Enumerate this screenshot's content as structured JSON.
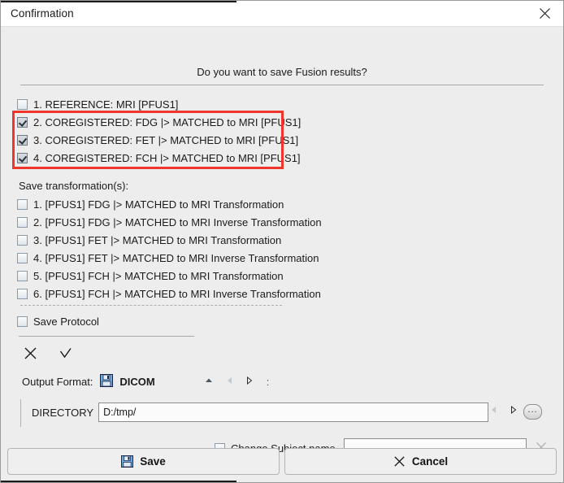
{
  "window": {
    "title": "Confirmation",
    "close_icon": "close-icon"
  },
  "question": "Do you want to save Fusion results?",
  "series": {
    "items": [
      {
        "label": "1. REFERENCE: MRI [PFUS1]",
        "checked": false
      },
      {
        "label": "2. COREGISTERED: FDG |> MATCHED to MRI [PFUS1]",
        "checked": true
      },
      {
        "label": "3. COREGISTERED: FET |> MATCHED to MRI [PFUS1]",
        "checked": true
      },
      {
        "label": "4. COREGISTERED: FCH |> MATCHED to MRI [PFUS1]",
        "checked": true
      }
    ],
    "highlight_color": "#f0352c"
  },
  "transformations": {
    "section_label": "Save transformation(s):",
    "items": [
      {
        "label": "1. [PFUS1] FDG |> MATCHED to MRI Transformation",
        "checked": false
      },
      {
        "label": "2. [PFUS1] FDG |> MATCHED to MRI Inverse Transformation",
        "checked": false
      },
      {
        "label": "3. [PFUS1] FET |> MATCHED to MRI Transformation",
        "checked": false
      },
      {
        "label": "4. [PFUS1] FET |> MATCHED to MRI Inverse Transformation",
        "checked": false
      },
      {
        "label": "5. [PFUS1] FCH |> MATCHED to MRI Transformation",
        "checked": false
      },
      {
        "label": "6. [PFUS1] FCH |> MATCHED to MRI Inverse Transformation",
        "checked": false
      }
    ]
  },
  "protocol": {
    "label": "Save Protocol",
    "checked": false
  },
  "toolbar": {
    "deselect_all_icon": "x-icon",
    "select_all_icon": "check-icon"
  },
  "output": {
    "label": "Output Format:",
    "format_icon": "floppy-disk-icon",
    "format": "DICOM",
    "up_icon": "triangle-up-icon",
    "prev_icon": "triangle-left-icon",
    "next_icon": "triangle-right-icon",
    "colon": ":"
  },
  "directory": {
    "label": "DIRECTORY",
    "value": "D:/tmp/",
    "placeholder": "",
    "prev_icon": "triangle-left-icon",
    "next_icon": "triangle-right-icon",
    "browse_label": "..."
  },
  "subject": {
    "label": "Change Subject name",
    "checked": false,
    "value": "",
    "placeholder": "",
    "clear_icon": "x-icon"
  },
  "footer": {
    "save_label": "Save",
    "save_icon": "floppy-disk-icon",
    "cancel_label": "Cancel",
    "cancel_icon": "x-icon"
  }
}
